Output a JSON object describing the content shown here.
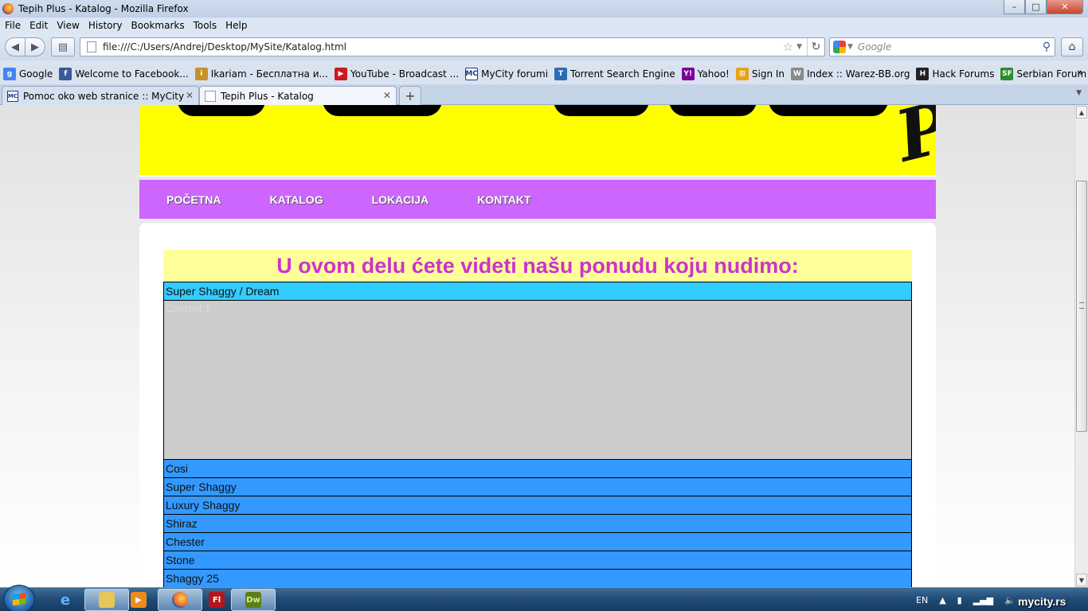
{
  "window": {
    "title": "Tepih Plus - Katalog - Mozilla Firefox",
    "buttons": {
      "minimize": "–",
      "maximize": "□",
      "close": "✕"
    }
  },
  "menu": [
    "File",
    "Edit",
    "View",
    "History",
    "Bookmarks",
    "Tools",
    "Help"
  ],
  "navbar": {
    "url": "file:///C:/Users/Andrej/Desktop/MySite/Katalog.html",
    "search_placeholder": "Google"
  },
  "bookmarks": [
    {
      "label": "Google",
      "icon": "google-icon",
      "color": "#4285f4"
    },
    {
      "label": "Welcome to Facebook...",
      "icon": "facebook-icon",
      "color": "#3b5998"
    },
    {
      "label": "Ikariam - Бесплатна и...",
      "icon": "ikariam-icon",
      "color": "#c8902a"
    },
    {
      "label": "YouTube - Broadcast ...",
      "icon": "youtube-icon",
      "color": "#cc181e"
    },
    {
      "label": "MyCity forumi",
      "icon": "mycity-icon",
      "color": "#1b3a8a"
    },
    {
      "label": "Torrent Search Engine",
      "icon": "torrent-icon",
      "color": "#2a6db5"
    },
    {
      "label": "Yahoo!",
      "icon": "yahoo-icon",
      "color": "#7b0099"
    },
    {
      "label": "Sign In",
      "icon": "windows-icon",
      "color": "#e8a317"
    },
    {
      "label": "Index :: Warez-BB.org",
      "icon": "warez-icon",
      "color": "#8a8a8a"
    },
    {
      "label": "Hack Forums",
      "icon": "hackforums-icon",
      "color": "#222222"
    },
    {
      "label": "Serbian Forum",
      "icon": "sf-icon",
      "color": "#2e8b2e"
    }
  ],
  "tabs": [
    {
      "label": "Pomoc oko web stranice :: MyCity",
      "icon": "MC"
    },
    {
      "label": "Tepih Plus - Katalog",
      "icon": ""
    }
  ],
  "page": {
    "nav": [
      "POČETNA",
      "KATALOG",
      "LOKACIJA",
      "KONTAKT"
    ],
    "heading": "U ovom delu ćete videti našu ponudu koju nudimo:",
    "open_panel": {
      "label": "Super Shaggy / Dream",
      "content": "Content 1"
    },
    "panels": [
      "Cosi",
      "Super Shaggy",
      "Luxury Shaggy",
      "Shiraz",
      "Chester",
      "Stone",
      "Shaggy 25"
    ],
    "colors": {
      "banner": "#ffff00",
      "nav": "#cc66ff",
      "heading_bg": "#ffff99",
      "heading_text": "#cc33cc",
      "panel_open": "#33ccff",
      "panel": "#3399ff",
      "panel_content": "#cccccc"
    }
  },
  "taskbar": {
    "language": "EN",
    "watermark": "mycity.rs"
  }
}
